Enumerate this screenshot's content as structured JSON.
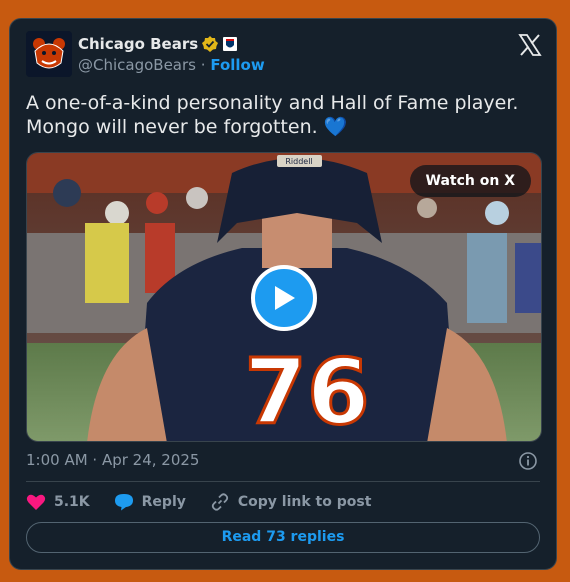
{
  "account": {
    "name": "Chicago Bears",
    "handle": "@ChicagoBears",
    "separator": "·",
    "follow_label": "Follow",
    "avatar_icon": "bears-logo-icon",
    "verified_icon": "verified-badge-icon",
    "affiliate_icon": "nfl-badge-icon"
  },
  "tweet": {
    "text": "A one-of-a-kind personality and Hall of Fame player. Mongo will never be forgotten. 💙"
  },
  "media": {
    "watch_label": "Watch on X",
    "play_icon": "play-icon",
    "jersey_number": "76",
    "helmet_brand": "Riddell"
  },
  "meta": {
    "timestamp": "1:00 AM · Apr 24, 2025"
  },
  "actions": {
    "likes": "5.1K",
    "reply_label": "Reply",
    "copy_link_label": "Copy link to post"
  },
  "footer": {
    "read_replies_label": "Read 73 replies"
  },
  "colors": {
    "background": "#c75a10",
    "card": "#15202b",
    "accent": "#1d9bf0",
    "like": "#f91880"
  }
}
